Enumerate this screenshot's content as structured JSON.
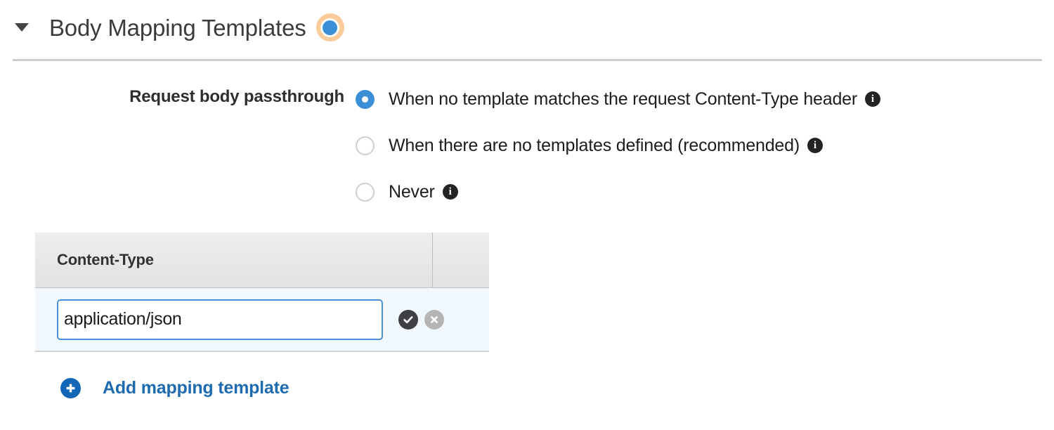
{
  "section": {
    "title": "Body Mapping Templates",
    "disclosure_icon": "caret-down-icon",
    "expanded": true,
    "status_indicator": {
      "icon": "status-dot-icon",
      "dot_color": "#3b8fd6",
      "halo_color": "#fbcc99"
    }
  },
  "passthrough": {
    "label": "Request body passthrough",
    "selected_index": 0,
    "options": [
      {
        "label": "When no template matches the request Content-Type header",
        "selected": true,
        "info_icon": "info-icon"
      },
      {
        "label": "When there are no templates defined (recommended)",
        "selected": false,
        "info_icon": "info-icon"
      },
      {
        "label": "Never",
        "selected": false,
        "info_icon": "info-icon"
      }
    ]
  },
  "templates_table": {
    "columns": [
      "Content-Type",
      ""
    ],
    "rows": [
      {
        "content_type_value": "application/json",
        "content_type_placeholder": "",
        "focused": true,
        "confirm_icon": "check-circle-icon",
        "cancel_icon": "x-circle-icon"
      }
    ]
  },
  "add_template": {
    "label": "Add mapping template",
    "icon": "plus-circle-icon",
    "color": "#1f6bb0"
  }
}
